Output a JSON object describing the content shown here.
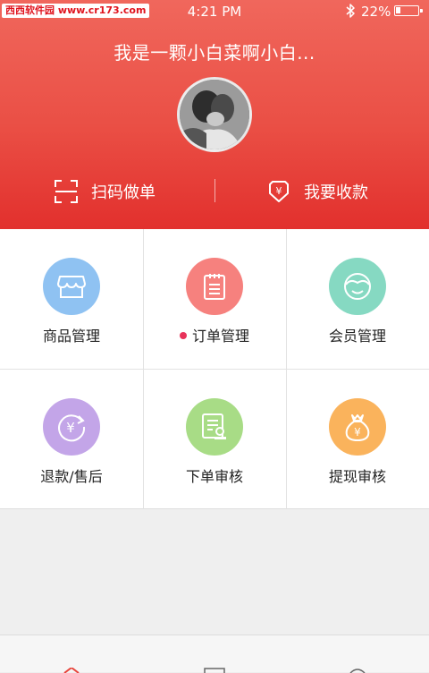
{
  "status_bar": {
    "watermark": "西西软件园 www.cr173.com",
    "time": "4:21 PM",
    "battery_percent": "22%",
    "battery_level": 0.22
  },
  "header": {
    "username": "我是一颗小白菜啊小白...",
    "scan_label": "扫码做单",
    "collect_label": "我要收款"
  },
  "grid": {
    "items": [
      {
        "label": "商品管理",
        "icon": "store-icon",
        "color": "#8fc2f2"
      },
      {
        "label": "订单管理",
        "icon": "order-icon",
        "color": "#f6817e",
        "badge": true
      },
      {
        "label": "会员管理",
        "icon": "member-icon",
        "color": "#86d9c2"
      },
      {
        "label": "退款/售后",
        "icon": "refund-icon",
        "color": "#c3a5e8"
      },
      {
        "label": "下单审核",
        "icon": "audit-icon",
        "color": "#a8dc86"
      },
      {
        "label": "提现审核",
        "icon": "withdraw-icon",
        "color": "#fab35c"
      }
    ]
  },
  "tabbar": {
    "tabs": [
      "home-tab-icon",
      "list-tab-icon",
      "profile-tab-icon"
    ]
  }
}
